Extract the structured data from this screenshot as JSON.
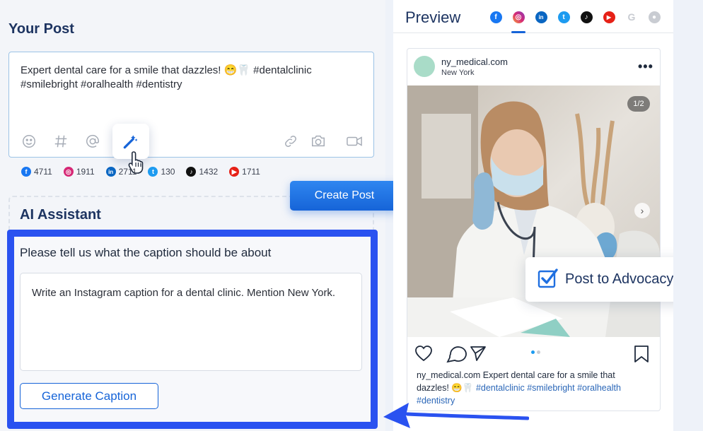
{
  "your_post": {
    "title": "Your Post",
    "text": "Expert dental care for a smile that dazzles! 😁🦷 #dentalclinic #smilebright #oralhealth #dentistry"
  },
  "toolbar_icons": [
    "emoji-icon",
    "hashtag-icon",
    "mention-icon",
    "magic-wand-icon",
    "link-icon",
    "camera-icon",
    "video-icon"
  ],
  "counts": [
    {
      "network": "facebook",
      "value": "4711",
      "color": "#1877f2"
    },
    {
      "network": "instagram",
      "value": "1911",
      "color": "#d62976"
    },
    {
      "network": "linkedin",
      "value": "2711",
      "color": "#0a66c2"
    },
    {
      "network": "twitter",
      "value": "130",
      "color": "#1d9bf0"
    },
    {
      "network": "tiktok",
      "value": "1432",
      "color": "#111111"
    },
    {
      "network": "youtube",
      "value": "1711",
      "color": "#e62117"
    }
  ],
  "create_post_label": "Create Post",
  "ai": {
    "title": "AI Assistant",
    "ask_label": "Please tell us what the caption should be about",
    "prompt": "Write an Instagram caption for a dental clinic. Mention New York.",
    "generate_label": "Generate Caption"
  },
  "preview": {
    "title": "Preview",
    "active_network": "instagram",
    "networks": [
      {
        "name": "facebook",
        "color": "#1877f2"
      },
      {
        "name": "instagram",
        "color": "#d62976"
      },
      {
        "name": "linkedin",
        "color": "#0a66c2"
      },
      {
        "name": "twitter",
        "color": "#1d9bf0"
      },
      {
        "name": "tiktok",
        "color": "#111111"
      },
      {
        "name": "youtube",
        "color": "#e62117"
      },
      {
        "name": "google",
        "color": "#c9ccd2"
      },
      {
        "name": "reddit",
        "color": "#c9ccd2"
      }
    ],
    "username": "ny_medical.com",
    "location": "New York",
    "image_counter": "1/2",
    "caption_user": "ny_medical.com",
    "caption_text": " Expert dental care for a smile that dazzles! 😁🦷 ",
    "caption_tags": "#dentalclinic #smilebright #oralhealth #dentistry"
  },
  "advocacy": {
    "label": "Post to Advocacy",
    "checked": true
  },
  "colors": {
    "accent": "#1664d8",
    "highlight": "#2a52f0",
    "title": "#1d3461"
  }
}
